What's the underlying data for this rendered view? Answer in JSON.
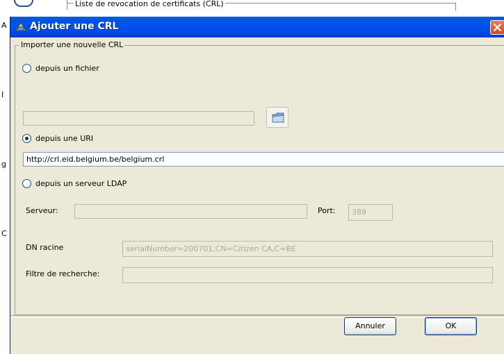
{
  "background": {
    "group_label": "Liste de revocation de certificats (CRL)",
    "edge_chars": [
      "A",
      "I",
      "g",
      "C"
    ]
  },
  "dialog": {
    "title": "Ajouter une CRL",
    "close_icon": "close-icon",
    "group": {
      "legend": "Importer une nouvelle CRL",
      "options": {
        "file": {
          "label": "depuis un fichier",
          "selected": false
        },
        "uri": {
          "label": "depuis une URI",
          "selected": true
        },
        "ldap": {
          "label": "depuis un serveur LDAP",
          "selected": false
        }
      },
      "file_path": {
        "value": "",
        "enabled": false
      },
      "browse_icon": "folder-icon",
      "uri": {
        "value": "http://crl.eid.belgium.be/belgium.crl"
      },
      "ldap": {
        "server_label": "Serveur:",
        "server_value": "",
        "port_label": "Port:",
        "port_value": "389",
        "dn_label": "DN racine",
        "dn_value": "serialNumber=200701,CN=Citizen CA,C=BE",
        "filter_label": "Filtre de recherche:",
        "filter_value": ""
      }
    },
    "buttons": {
      "cancel": "Annuler",
      "ok": "OK"
    }
  },
  "colors": {
    "titlebar": "#0054e3",
    "dialog_bg": "#ece9d8",
    "close_button": "#d34a22"
  }
}
